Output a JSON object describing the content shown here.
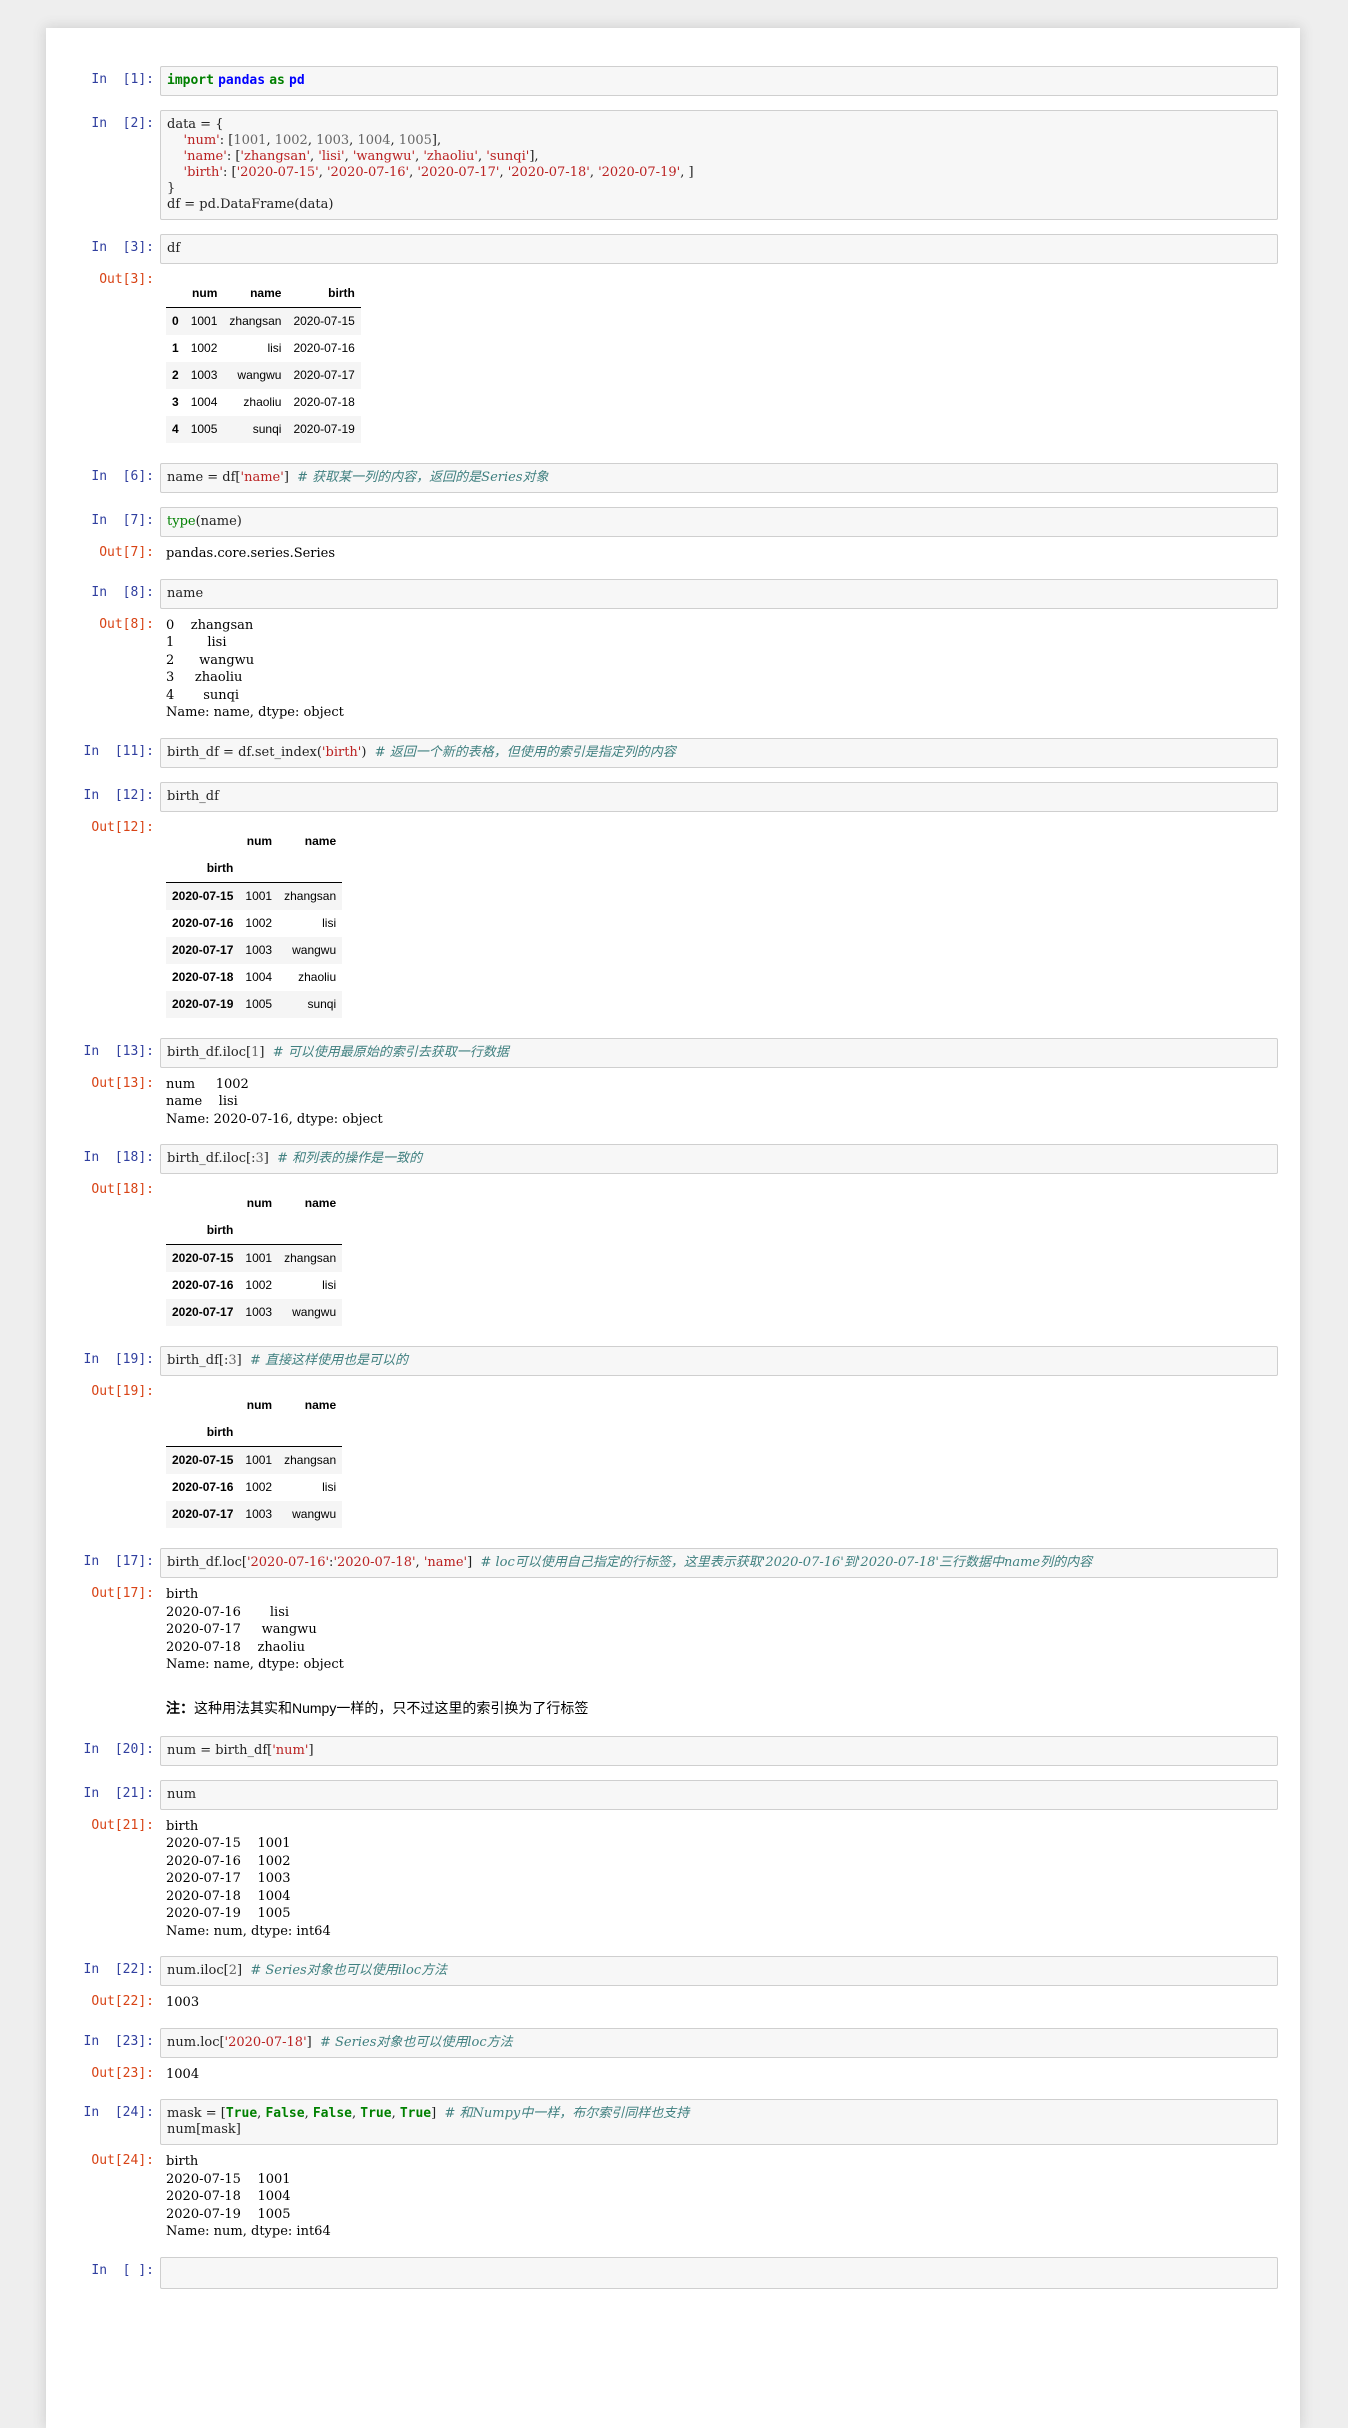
{
  "cells": [
    {
      "type": "code",
      "prompt": "In  [1]:",
      "src": [
        [
          "kw",
          "import"
        ],
        [
          "t",
          " "
        ],
        [
          "ns",
          "pandas"
        ],
        [
          "t",
          " "
        ],
        [
          "kw",
          "as"
        ],
        [
          "t",
          " "
        ],
        [
          "ns",
          "pd"
        ]
      ]
    },
    {
      "type": "code",
      "prompt": "In  [2]:",
      "src": [
        [
          "t",
          "data = {\n    "
        ],
        [
          "str",
          "'num'"
        ],
        [
          "t",
          ": ["
        ],
        [
          "num",
          "1001"
        ],
        [
          "t",
          ", "
        ],
        [
          "num",
          "1002"
        ],
        [
          "t",
          ", "
        ],
        [
          "num",
          "1003"
        ],
        [
          "t",
          ", "
        ],
        [
          "num",
          "1004"
        ],
        [
          "t",
          ", "
        ],
        [
          "num",
          "1005"
        ],
        [
          "t",
          "],\n    "
        ],
        [
          "str",
          "'name'"
        ],
        [
          "t",
          ": ["
        ],
        [
          "str",
          "'zhangsan'"
        ],
        [
          "t",
          ", "
        ],
        [
          "str",
          "'lisi'"
        ],
        [
          "t",
          ", "
        ],
        [
          "str",
          "'wangwu'"
        ],
        [
          "t",
          ", "
        ],
        [
          "str",
          "'zhaoliu'"
        ],
        [
          "t",
          ", "
        ],
        [
          "str",
          "'sunqi'"
        ],
        [
          "t",
          "],\n    "
        ],
        [
          "str",
          "'birth'"
        ],
        [
          "t",
          ": ["
        ],
        [
          "str",
          "'2020-07-15'"
        ],
        [
          "t",
          ", "
        ],
        [
          "str",
          "'2020-07-16'"
        ],
        [
          "t",
          ", "
        ],
        [
          "str",
          "'2020-07-17'"
        ],
        [
          "t",
          ", "
        ],
        [
          "str",
          "'2020-07-18'"
        ],
        [
          "t",
          ", "
        ],
        [
          "str",
          "'2020-07-19'"
        ],
        [
          "t",
          ", ]\n}\ndf = pd.DataFrame(data)"
        ]
      ]
    },
    {
      "type": "code",
      "prompt": "In  [3]:",
      "src": [
        [
          "t",
          "df"
        ]
      ]
    },
    {
      "type": "table",
      "prompt": "Out[3]:",
      "columns": [
        "num",
        "name",
        "birth"
      ],
      "rows": [
        [
          "0",
          "1001",
          "zhangsan",
          "2020-07-15"
        ],
        [
          "1",
          "1002",
          "lisi",
          "2020-07-16"
        ],
        [
          "2",
          "1003",
          "wangwu",
          "2020-07-17"
        ],
        [
          "3",
          "1004",
          "zhaoliu",
          "2020-07-18"
        ],
        [
          "4",
          "1005",
          "sunqi",
          "2020-07-19"
        ]
      ]
    },
    {
      "type": "code",
      "prompt": "In  [6]:",
      "src": [
        [
          "t",
          "name = df["
        ],
        [
          "str",
          "'name'"
        ],
        [
          "t",
          "]  "
        ],
        [
          "cmt",
          "# 获取某一列的内容，返回的是Series对象"
        ]
      ]
    },
    {
      "type": "code",
      "prompt": "In  [7]:",
      "src": [
        [
          "bi",
          "type"
        ],
        [
          "t",
          "(name)"
        ]
      ]
    },
    {
      "type": "text",
      "prompt": "Out[7]:",
      "text": "pandas.core.series.Series"
    },
    {
      "type": "code",
      "prompt": "In  [8]:",
      "src": [
        [
          "t",
          "name"
        ]
      ]
    },
    {
      "type": "text",
      "prompt": "Out[8]:",
      "text": "0    zhangsan\n1        lisi\n2      wangwu\n3     zhaoliu\n4       sunqi\nName: name, dtype: object"
    },
    {
      "type": "code",
      "prompt": "In  [11]:",
      "src": [
        [
          "t",
          "birth_df = df.set_index("
        ],
        [
          "str",
          "'birth'"
        ],
        [
          "t",
          ")  "
        ],
        [
          "cmt",
          "# 返回一个新的表格，但使用的索引是指定列的内容"
        ]
      ]
    },
    {
      "type": "code",
      "prompt": "In  [12]:",
      "src": [
        [
          "t",
          "birth_df"
        ]
      ]
    },
    {
      "type": "table",
      "prompt": "Out[12]:",
      "columns": [
        "num",
        "name"
      ],
      "index_name": "birth",
      "rows": [
        [
          "2020-07-15",
          "1001",
          "zhangsan"
        ],
        [
          "2020-07-16",
          "1002",
          "lisi"
        ],
        [
          "2020-07-17",
          "1003",
          "wangwu"
        ],
        [
          "2020-07-18",
          "1004",
          "zhaoliu"
        ],
        [
          "2020-07-19",
          "1005",
          "sunqi"
        ]
      ]
    },
    {
      "type": "code",
      "prompt": "In  [13]:",
      "src": [
        [
          "t",
          "birth_df.iloc["
        ],
        [
          "num",
          "1"
        ],
        [
          "t",
          "]  "
        ],
        [
          "cmt",
          "# 可以使用最原始的索引去获取一行数据"
        ]
      ]
    },
    {
      "type": "text",
      "prompt": "Out[13]:",
      "text": "num     1002\nname    lisi\nName: 2020-07-16, dtype: object"
    },
    {
      "type": "code",
      "prompt": "In  [18]:",
      "src": [
        [
          "t",
          "birth_df.iloc[:"
        ],
        [
          "num",
          "3"
        ],
        [
          "t",
          "]  "
        ],
        [
          "cmt",
          "# 和列表的操作是一致的"
        ]
      ]
    },
    {
      "type": "table",
      "prompt": "Out[18]:",
      "columns": [
        "num",
        "name"
      ],
      "index_name": "birth",
      "rows": [
        [
          "2020-07-15",
          "1001",
          "zhangsan"
        ],
        [
          "2020-07-16",
          "1002",
          "lisi"
        ],
        [
          "2020-07-17",
          "1003",
          "wangwu"
        ]
      ]
    },
    {
      "type": "code",
      "prompt": "In  [19]:",
      "src": [
        [
          "t",
          "birth_df[:"
        ],
        [
          "num",
          "3"
        ],
        [
          "t",
          "]  "
        ],
        [
          "cmt",
          "# 直接这样使用也是可以的"
        ]
      ]
    },
    {
      "type": "table",
      "prompt": "Out[19]:",
      "columns": [
        "num",
        "name"
      ],
      "index_name": "birth",
      "rows": [
        [
          "2020-07-15",
          "1001",
          "zhangsan"
        ],
        [
          "2020-07-16",
          "1002",
          "lisi"
        ],
        [
          "2020-07-17",
          "1003",
          "wangwu"
        ]
      ]
    },
    {
      "type": "code",
      "prompt": "In  [17]:",
      "src": [
        [
          "t",
          "birth_df.loc["
        ],
        [
          "str",
          "'2020-07-16'"
        ],
        [
          "t",
          ":"
        ],
        [
          "str",
          "'2020-07-18'"
        ],
        [
          "t",
          ", "
        ],
        [
          "str",
          "'name'"
        ],
        [
          "t",
          "]  "
        ],
        [
          "cmt",
          "# loc可以使用自己指定的行标签，这里表示获取'2020-07-16'到'2020-07-18'三行数据中name列的内容"
        ]
      ]
    },
    {
      "type": "text",
      "prompt": "Out[17]:",
      "text": "birth\n2020-07-16       lisi\n2020-07-17     wangwu\n2020-07-18    zhaoliu\nName: name, dtype: object"
    },
    {
      "type": "markdown",
      "prompt": "",
      "bold": "注：",
      "text": "这种用法其实和Numpy一样的，只不过这里的索引换为了行标签"
    },
    {
      "type": "code",
      "prompt": "In  [20]:",
      "src": [
        [
          "t",
          "num = birth_df["
        ],
        [
          "str",
          "'num'"
        ],
        [
          "t",
          "]"
        ]
      ]
    },
    {
      "type": "code",
      "prompt": "In  [21]:",
      "src": [
        [
          "t",
          "num"
        ]
      ]
    },
    {
      "type": "text",
      "prompt": "Out[21]:",
      "text": "birth\n2020-07-15    1001\n2020-07-16    1002\n2020-07-17    1003\n2020-07-18    1004\n2020-07-19    1005\nName: num, dtype: int64"
    },
    {
      "type": "code",
      "prompt": "In  [22]:",
      "src": [
        [
          "t",
          "num.iloc["
        ],
        [
          "num",
          "2"
        ],
        [
          "t",
          "]  "
        ],
        [
          "cmt",
          "# Series对象也可以使用iloc方法"
        ]
      ]
    },
    {
      "type": "text",
      "prompt": "Out[22]:",
      "text": "1003"
    },
    {
      "type": "code",
      "prompt": "In  [23]:",
      "src": [
        [
          "t",
          "num.loc["
        ],
        [
          "str",
          "'2020-07-18'"
        ],
        [
          "t",
          "]  "
        ],
        [
          "cmt",
          "# Series对象也可以使用loc方法"
        ]
      ]
    },
    {
      "type": "text",
      "prompt": "Out[23]:",
      "text": "1004"
    },
    {
      "type": "code",
      "prompt": "In  [24]:",
      "src": [
        [
          "t",
          "mask = ["
        ],
        [
          "kw",
          "True"
        ],
        [
          "t",
          ", "
        ],
        [
          "kw",
          "False"
        ],
        [
          "t",
          ", "
        ],
        [
          "kw",
          "False"
        ],
        [
          "t",
          ", "
        ],
        [
          "kw",
          "True"
        ],
        [
          "t",
          ", "
        ],
        [
          "kw",
          "True"
        ],
        [
          "t",
          "]  "
        ],
        [
          "cmt",
          "# 和Numpy中一样，布尔索引同样也支持"
        ],
        [
          "t",
          "\nnum[mask]"
        ]
      ]
    },
    {
      "type": "text",
      "prompt": "Out[24]:",
      "text": "birth\n2020-07-15    1001\n2020-07-18    1004\n2020-07-19    1005\nName: num, dtype: int64"
    },
    {
      "type": "code",
      "prompt": "In  [ ]:",
      "src": []
    }
  ]
}
